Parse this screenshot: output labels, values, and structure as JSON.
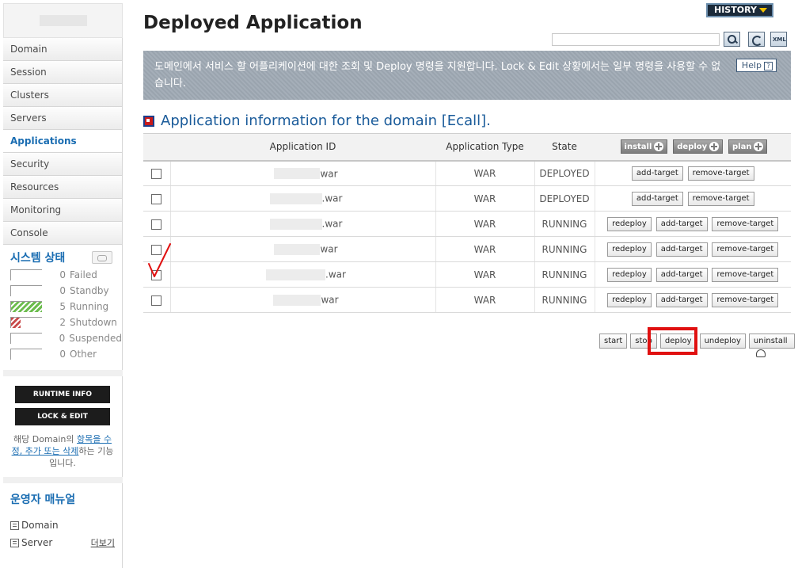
{
  "sidebar": {
    "nav": [
      {
        "label": "Domain"
      },
      {
        "label": "Session"
      },
      {
        "label": "Clusters"
      },
      {
        "label": "Servers"
      },
      {
        "label": "Applications"
      },
      {
        "label": "Security"
      },
      {
        "label": "Resources"
      },
      {
        "label": "Monitoring"
      },
      {
        "label": "Console"
      }
    ],
    "system_status": {
      "title": "시스템 상태",
      "rows": [
        {
          "count": "0",
          "label": "Failed",
          "fraction": 0,
          "color": "#ffffff"
        },
        {
          "count": "0",
          "label": "Standby",
          "fraction": 0,
          "color": "#ffffff"
        },
        {
          "count": "5",
          "label": "Running",
          "fraction": 1,
          "color": "#6cbc4e"
        },
        {
          "count": "2",
          "label": "Shutdown",
          "fraction": 0.3,
          "color": "#c84a4a"
        },
        {
          "count": "0",
          "label": "Suspended",
          "fraction": 0,
          "color": "#ffffff"
        },
        {
          "count": "0",
          "label": "Other",
          "fraction": 0,
          "color": "#ffffff"
        }
      ]
    },
    "runtime_info_label": "RUNTIME INFO",
    "lock_edit_label": "LOCK & EDIT",
    "lock_note": {
      "part1": "해당 Domain의 ",
      "link1": "항목을 수정, 추가 또는 삭제",
      "part2": "하는 기능입니다."
    },
    "manual": {
      "title": "운영자 매뉴얼",
      "items": [
        "Domain",
        "Server"
      ],
      "more_label": "더보기"
    }
  },
  "header": {
    "history_label": "HISTORY",
    "title": "Deployed Application",
    "search": {
      "value": "",
      "placeholder": ""
    },
    "icons": [
      "search-icon",
      "refresh-icon",
      "xml-icon"
    ]
  },
  "banner": {
    "text": "도메인에서 서비스 할 어플리케이션에 대한 조회 및 Deploy 명령을 지원합니다. Lock & Edit 상황에서는 일부 명령을 사용할 수 없습니다.",
    "help_label": "Help",
    "help_q": "?"
  },
  "section": {
    "title": "Application information for the domain [Ecall]."
  },
  "table": {
    "headers": {
      "id": "Application ID",
      "type": "Application Type",
      "state": "State",
      "install": "install",
      "deploy": "deploy",
      "plan": "plan"
    },
    "rows": [
      {
        "id_suffix": "war",
        "type": "WAR",
        "state": "DEPLOYED",
        "checked": false
      },
      {
        "id_suffix": ".war",
        "type": "WAR",
        "state": "DEPLOYED",
        "checked": false
      },
      {
        "id_suffix": ".war",
        "type": "WAR",
        "state": "RUNNING",
        "checked": false
      },
      {
        "id_suffix": "war",
        "type": "WAR",
        "state": "RUNNING",
        "checked": false
      },
      {
        "id_suffix": ".war",
        "type": "WAR",
        "state": "RUNNING",
        "checked": true
      },
      {
        "id_suffix": "war",
        "type": "WAR",
        "state": "RUNNING",
        "checked": false
      }
    ],
    "action_labels": {
      "redeploy": "redeploy",
      "add_target": "add-target",
      "remove_target": "remove-target"
    }
  },
  "bottom_actions": {
    "start": "start",
    "stop": "stop",
    "deploy": "deploy",
    "undeploy": "undeploy",
    "uninstall": "uninstall"
  },
  "colors": {
    "accent_blue": "#1a6db2",
    "banner_gray": "#9fa9b4",
    "highlight_red": "#e01010",
    "history_navy": "#1b2a3a"
  }
}
